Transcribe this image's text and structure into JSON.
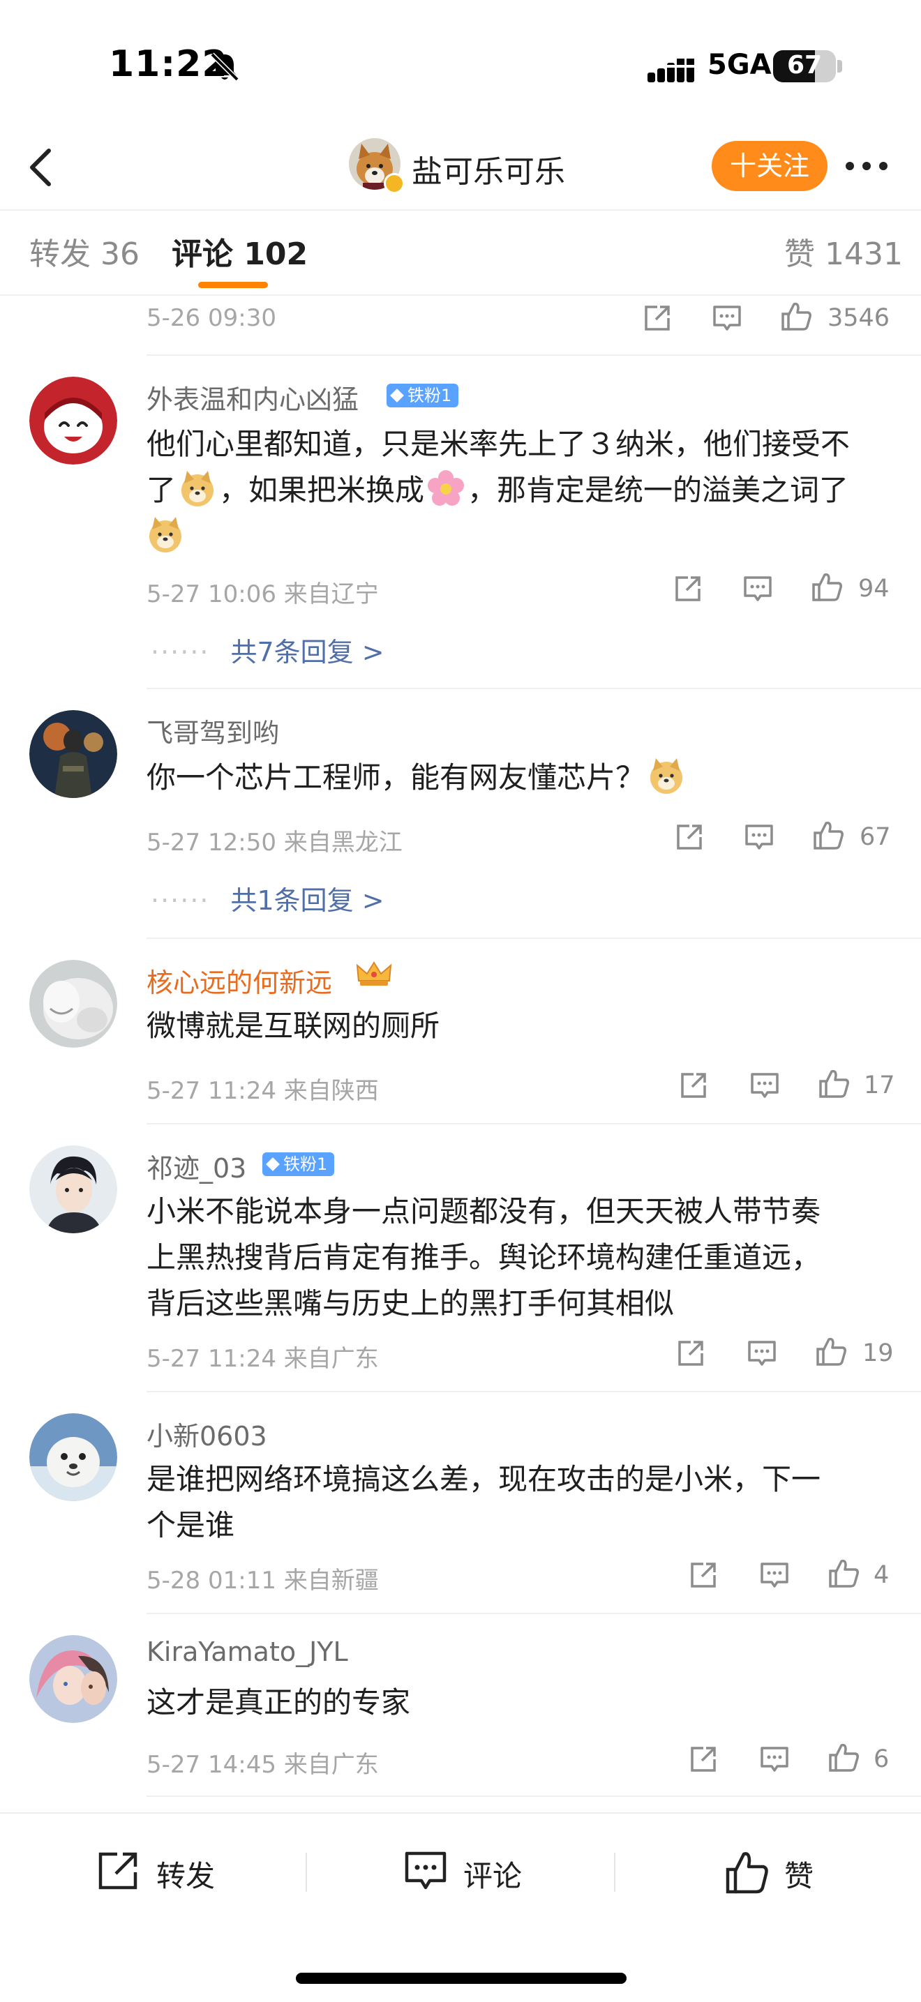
{
  "status_bar": {
    "time": "11:22",
    "network": "5GA",
    "battery": "67",
    "battery_level": 0.67
  },
  "header": {
    "name": "盐可乐可乐",
    "follow_label": "十关注"
  },
  "tabs": {
    "repost": "转发 36",
    "comment": "评论 102",
    "like": "赞 1431"
  },
  "top_partial": {
    "time": "5-26 09:30",
    "likes": "3546"
  },
  "comments": [
    {
      "username": "外表温和内心凶猛",
      "badge": "铁粉1",
      "line1": "他们心里都知道，只是米率先上了３纳米，他们接受不",
      "line2a": "了",
      "line2b": "，如果把米换成",
      "line2c": "，那肯定是统一的溢美之词了",
      "time": "5-27 10:06 来自辽宁",
      "likes": "94",
      "replies": "共7条回复 >"
    },
    {
      "username": "飞哥驾到哟",
      "text": "你一个芯片工程师，能有网友懂芯片？",
      "time": "5-27 12:50 来自黑龙江",
      "likes": "67",
      "replies": "共1条回复 >"
    },
    {
      "username": "核心远的何新远",
      "text": "微博就是互联网的厕所",
      "time": "5-27 11:24 来自陕西",
      "likes": "17"
    },
    {
      "username": "祁迹_03",
      "badge": "铁粉1",
      "line1": "小米不能说本身一点问题都没有，但天天被人带节奏",
      "line2": "上黑热搜背后肯定有推手。舆论环境构建任重道远，",
      "line3": "背后这些黑嘴与历史上的黑打手何其相似",
      "time": "5-27 11:24 来自广东",
      "likes": "19"
    },
    {
      "username": "小新0603",
      "line1": "是谁把网络环境搞这么差，现在攻击的是小米，下一",
      "line2": "个是谁",
      "time": "5-28 01:11 来自新疆",
      "likes": "4"
    },
    {
      "username": "KiraYamato_JYL",
      "text": "这才是真正的的专家",
      "time": "5-27 14:45 来自广东",
      "likes": "6"
    }
  ],
  "bottom_bar": {
    "repost": "转发",
    "comment": "评论",
    "like": "赞"
  },
  "colors": {
    "accent": "#ff8200",
    "follow_button": "#ff8c1a",
    "link": "#506fa8",
    "fan_badge": "#5aa2ff",
    "vip_name": "#e86c1f"
  },
  "icons": [
    "bell-mute-icon",
    "signal-icon",
    "back-icon",
    "more-icon",
    "share-icon",
    "comment-icon",
    "like-icon",
    "doge-emoji",
    "flower-emoji",
    "crown-icon"
  ]
}
